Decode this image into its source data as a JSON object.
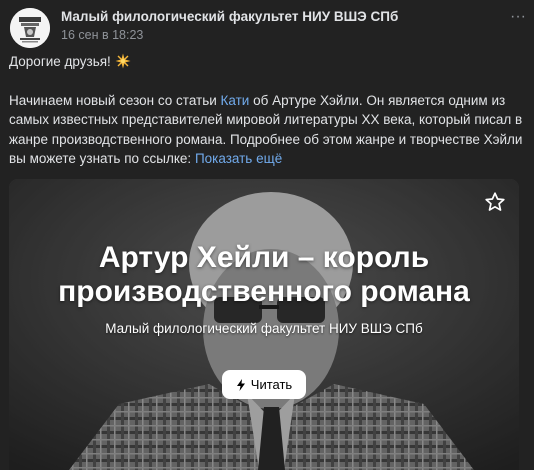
{
  "post": {
    "community_name": "Малый филологический факультет НИУ ВШЭ СПб",
    "date": "16 сен в 18:23",
    "more_label": "···",
    "greeting": "Дорогие друзья!",
    "greeting_emoji": "sparkle-icon",
    "body_lines": {
      "l1_before_link": "Начинаем новый сезон со статьи ",
      "l1_link": "Кати",
      "l1_after_link": " об Артуре Хэйли. Он является одним из",
      "l2": "самых известных представителей мировой литературы XX века, который писал в",
      "l3": "жанре производственного романа. Подробнее об этом жанре и творчестве Хэйли",
      "l4": "вы можете узнать по ссылке: ",
      "show_more": "Показать ещё"
    },
    "colors": {
      "background": "#222222",
      "text": "#e1e3e6",
      "secondary": "#8f9399",
      "link": "#71aaeb"
    }
  },
  "card": {
    "title_line1": "Артур Хейли – король",
    "title_line2": "производственного романа",
    "subtitle": "Малый филологический факультет НИУ ВШЭ СПб",
    "read_button": "Читать",
    "read_icon": "bolt-icon",
    "bookmark_icon": "star-bookmark-icon"
  }
}
